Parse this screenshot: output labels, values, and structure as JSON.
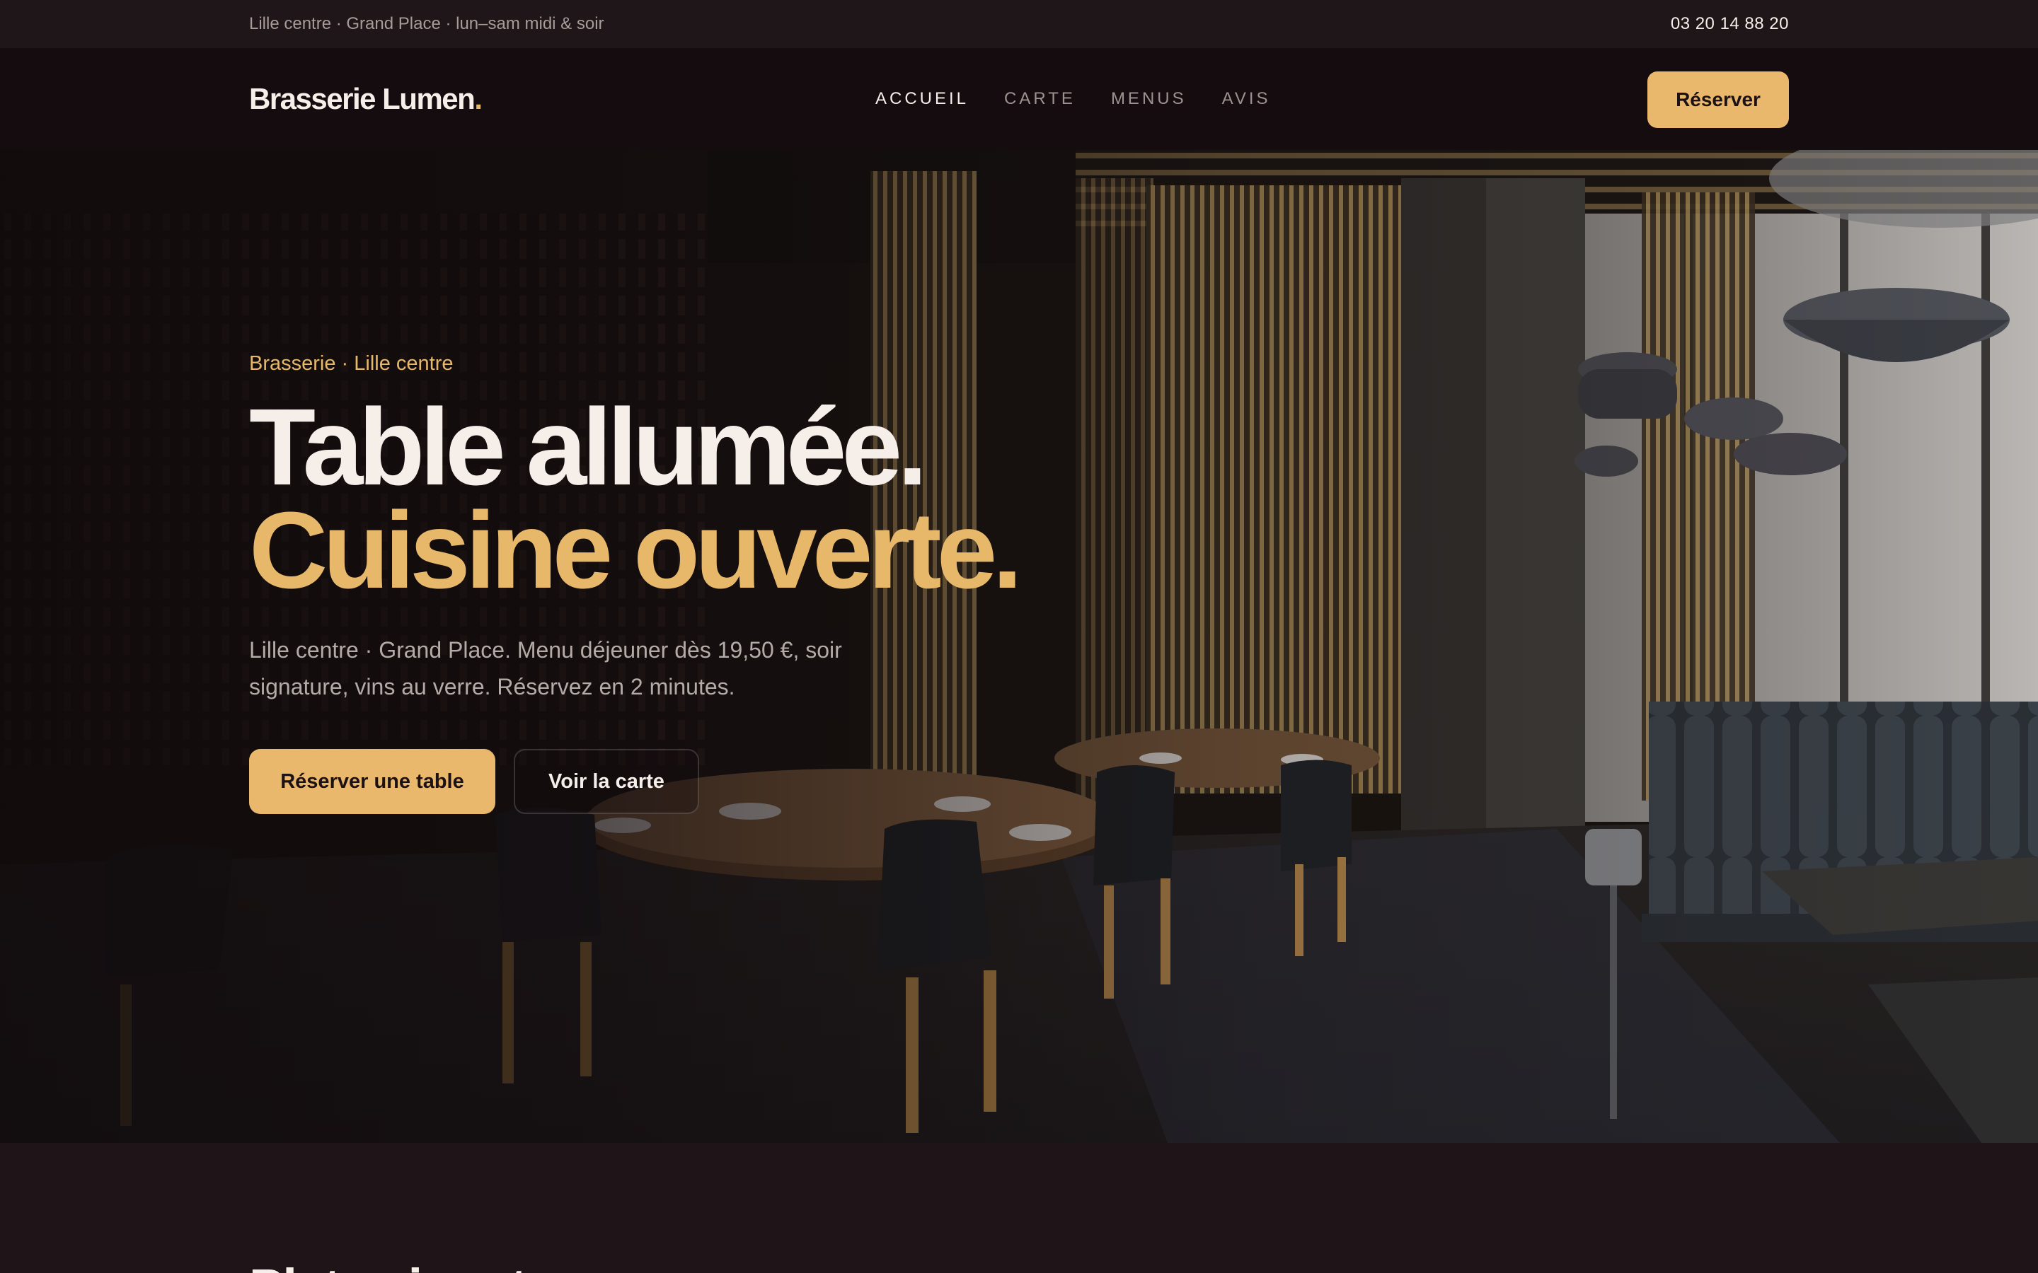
{
  "topbar": {
    "info": "Lille centre · Grand Place · lun–sam midi & soir",
    "phone": "03 20 14 88 20"
  },
  "nav": {
    "logo": "Brasserie Lumen",
    "logo_dot": ".",
    "links": [
      {
        "label": "ACCUEIL",
        "active": true
      },
      {
        "label": "CARTE",
        "active": false
      },
      {
        "label": "MENUS",
        "active": false
      },
      {
        "label": "AVIS",
        "active": false
      }
    ],
    "cta": "Réserver"
  },
  "hero": {
    "eyebrow": "Brasserie · Lille centre",
    "headline_line1": "Table allumée.",
    "headline_line2": "Cuisine ouverte.",
    "lede": "Lille centre · Grand Place. Menu déjeuner dès 19,50 €, soir signature, vins au verre. Réservez en 2 minutes.",
    "primary_cta": "Réserver une table",
    "secondary_cta": "Voir la carte",
    "image_icon": "restaurant-interior-photo"
  },
  "next_section": {
    "title": "Plats signature"
  },
  "colors": {
    "accent": "#e9b86c",
    "background": "#1e1418",
    "nav_background": "#140c0f",
    "text": "#f6efe9"
  }
}
